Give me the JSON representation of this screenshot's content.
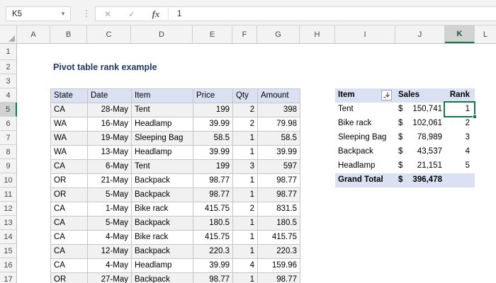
{
  "formula_bar": {
    "name_box_value": "K5",
    "formula_value": "1",
    "icons": {
      "dropdown": "▾",
      "menu_dots": "⋮",
      "cancel": "✕",
      "enter": "✓",
      "function": "fx"
    }
  },
  "sheet": {
    "column_headers": [
      "A",
      "B",
      "C",
      "D",
      "E",
      "F",
      "G",
      "H",
      "I",
      "J",
      "K",
      "L"
    ],
    "selected_column": "K",
    "row_headers": [
      "1",
      "2",
      "3",
      "4",
      "5",
      "6",
      "7",
      "8",
      "9",
      "10",
      "11",
      "12",
      "13",
      "14",
      "15",
      "16",
      "17"
    ],
    "selected_row": "5",
    "selected_cell": "K5",
    "title": "Pivot table rank example"
  },
  "data_table": {
    "headers": [
      "State",
      "Date",
      "Item",
      "Price",
      "Qty",
      "Amount"
    ],
    "rows": [
      [
        "CA",
        "28-May",
        "Tent",
        "199",
        "2",
        "398"
      ],
      [
        "WA",
        "16-May",
        "Headlamp",
        "39.99",
        "2",
        "79.98"
      ],
      [
        "WA",
        "19-May",
        "Sleeping Bag",
        "58.5",
        "1",
        "58.5"
      ],
      [
        "WA",
        "13-May",
        "Headlamp",
        "39.99",
        "1",
        "39.99"
      ],
      [
        "CA",
        "6-May",
        "Tent",
        "199",
        "3",
        "597"
      ],
      [
        "OR",
        "21-May",
        "Backpack",
        "98.77",
        "1",
        "98.77"
      ],
      [
        "OR",
        "5-May",
        "Backpack",
        "98.77",
        "1",
        "98.77"
      ],
      [
        "CA",
        "1-May",
        "Bike rack",
        "415.75",
        "2",
        "831.5"
      ],
      [
        "CA",
        "5-May",
        "Backpack",
        "180.5",
        "1",
        "180.5"
      ],
      [
        "CA",
        "4-May",
        "Bike rack",
        "415.75",
        "1",
        "415.75"
      ],
      [
        "CA",
        "12-May",
        "Backpack",
        "220.3",
        "1",
        "220.3"
      ],
      [
        "CA",
        "4-May",
        "Headlamp",
        "39.99",
        "4",
        "159.96"
      ],
      [
        "OR",
        "27-May",
        "Backpack",
        "98.77",
        "1",
        "98.77"
      ]
    ]
  },
  "pivot_table": {
    "headers": [
      "Item",
      "Sales",
      "Rank"
    ],
    "rows": [
      {
        "item": "Tent",
        "currency": "$",
        "sales": "150,741",
        "rank": "1"
      },
      {
        "item": "Bike rack",
        "currency": "$",
        "sales": "102,061",
        "rank": "2"
      },
      {
        "item": "Sleeping Bag",
        "currency": "$",
        "sales": "78,989",
        "rank": "3"
      },
      {
        "item": "Backpack",
        "currency": "$",
        "sales": "43,537",
        "rank": "4"
      },
      {
        "item": "Headlamp",
        "currency": "$",
        "sales": "21,151",
        "rank": "5"
      }
    ],
    "grand_total": {
      "label": "Grand Total",
      "currency": "$",
      "sales": "396,478"
    }
  },
  "colors": {
    "selection_green": "#107C41",
    "table_header_fill": "#D9E1F2",
    "row_band_fill": "#F1F1F1",
    "title_text": "#1F3864"
  }
}
